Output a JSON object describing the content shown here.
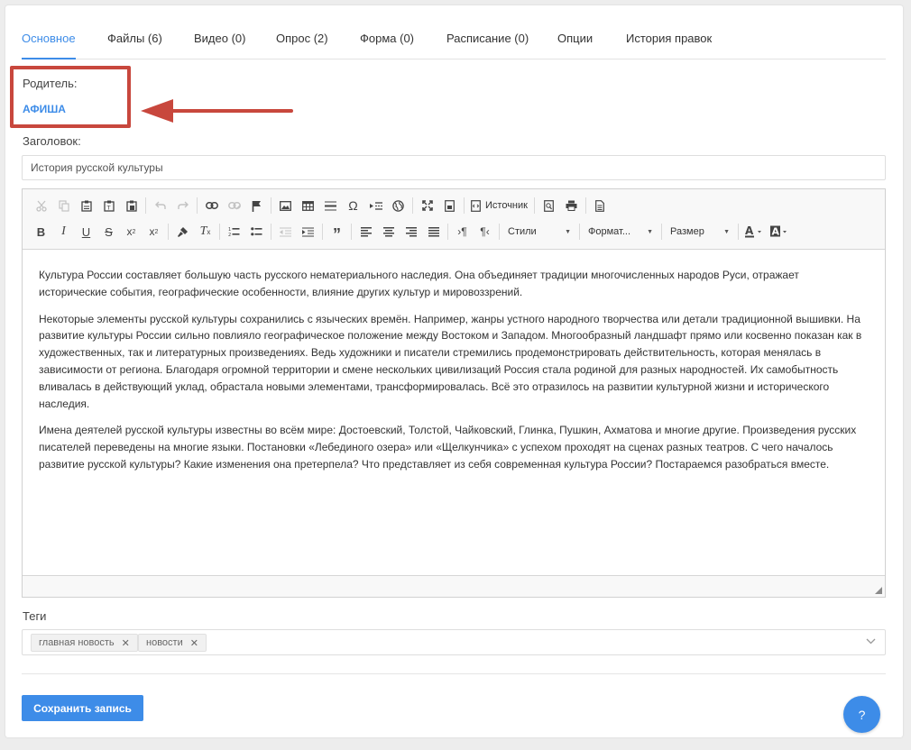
{
  "tabs": [
    {
      "label": "Основное",
      "active": true
    },
    {
      "label": "Файлы (6)"
    },
    {
      "label": "Видео (0)"
    },
    {
      "label": "Опрос (2)"
    },
    {
      "label": "Форма (0)"
    },
    {
      "label": "Расписание (0)"
    },
    {
      "label": "Опции"
    },
    {
      "label": "История правок"
    }
  ],
  "parent": {
    "label": "Родитель:",
    "value": "АФИША"
  },
  "title": {
    "label": "Заголовок:",
    "value": "История русской культуры"
  },
  "editor": {
    "toolbar": {
      "source_label": "Источник",
      "styles_label": "Стили",
      "format_label": "Формат...",
      "size_label": "Размер"
    },
    "paragraphs": [
      "Культура России составляет большую часть русского нематериального наследия. Она объединяет традиции многочисленных народов Руси, отражает исторические события, географические особенности, влияние других культур и мировоззрений.",
      "Некоторые элементы русской культуры сохранились с языческих времён. Например, жанры устного народного творчества или детали традиционной вышивки. На развитие культуры России сильно повлияло географическое положение между Востоком и Западом. Многообразный ландшафт прямо или косвенно показан как в художественных, так и литературных произведениях. Ведь художники и писатели стремились продемонстрировать действительность, которая менялась в зависимости от региона. Благодаря огромной территории и смене нескольких цивилизаций Россия стала родиной для разных народностей. Их самобытность вливалась в действующий уклад, обрастала новыми элементами, трансформировалась. Всё это отразилось на развитии культурной жизни и исторического наследия.",
      "Имена деятелей русской культуры известны во всём мире: Достоевский, Толстой, Чайковский, Глинка, Пушкин, Ахматова и многие другие. Произведения русских писателей переведены на многие языки. Постановки «Лебединого озера» или «Щелкунчика» с успехом проходят на сценах разных театров. С чего началось развитие русской культуры? Какие изменения она претерпела? Что представляет из себя современная культура России? Постараемся разобраться вместе."
    ]
  },
  "tags": {
    "label": "Теги",
    "items": [
      "главная новость",
      "новости"
    ]
  },
  "save_label": "Сохранить запись",
  "help_label": "?",
  "colors": {
    "accent": "#3d8ce8",
    "highlight": "#c8473d"
  }
}
